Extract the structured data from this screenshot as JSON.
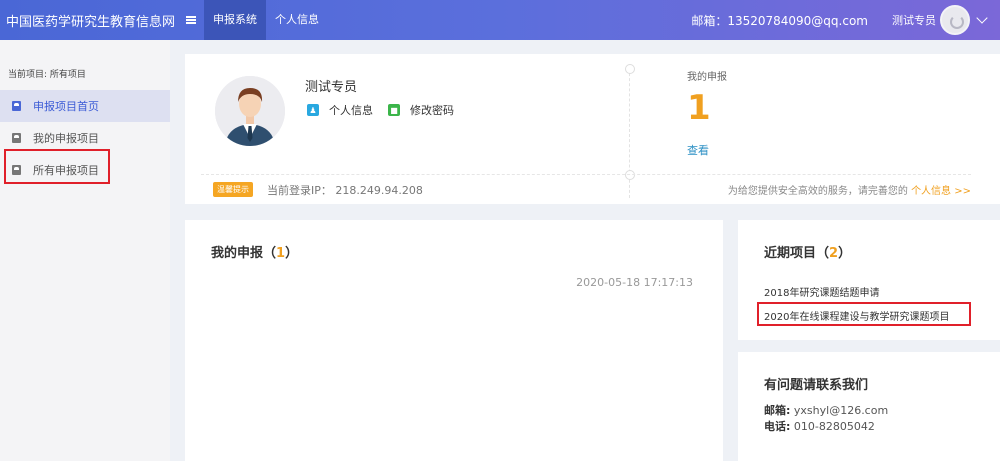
{
  "header": {
    "brand": "中国医药学研究生教育信息网",
    "nav": [
      {
        "label": "申报系统",
        "active": true
      },
      {
        "label": "个人信息",
        "active": false
      }
    ],
    "email_text": "邮箱：13520784090@qq.com",
    "user_name": "测试专员"
  },
  "sidebar": {
    "current_label": "当前项目: 所有项目",
    "items": [
      {
        "label": "申报项目首页",
        "active": true
      },
      {
        "label": "我的申报项目",
        "active": false
      },
      {
        "label": "所有申报项目",
        "active": false
      }
    ]
  },
  "profile": {
    "name": "测试专员",
    "personal_info_link": "个人信息",
    "change_password_link": "修改密码",
    "my_applications_label": "我的申报",
    "my_applications_count": "1",
    "view_link": "查看",
    "tip_badge": "温馨提示",
    "login_ip": "当前登录IP： 218.249.94.208",
    "tip_message": "为给您提供安全高效的服务，请完善您的",
    "tip_link": "个人信息 >>"
  },
  "my_applications": {
    "title": "我的申报",
    "count": "1",
    "date": "2020-05-18 17:17:13"
  },
  "recent_projects": {
    "title": "近期项目",
    "count": "2",
    "items": [
      "2018年研究课题结题申请",
      "2020年在线课程建设与教学研究课题项目"
    ]
  },
  "contact": {
    "title": "有问题请联系我们",
    "email_label": "邮箱:",
    "email_value": "yxshyl@126.com",
    "phone_label": "电话:",
    "phone_value": "010-82805042"
  },
  "colors": {
    "accent": "#4a67d6",
    "highlight_red": "#e0202a",
    "orange": "#f0a020",
    "link_blue": "#2b8fc4"
  }
}
